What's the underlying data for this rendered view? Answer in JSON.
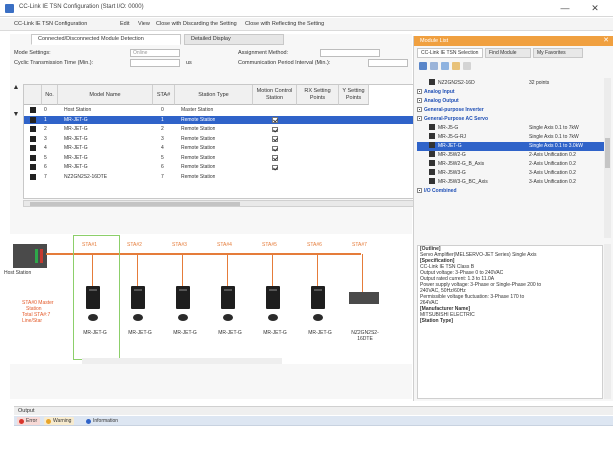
{
  "window": {
    "title": "CC-Link IE TSN Configuration (Start I/O: 0000)",
    "min_glyph": "—",
    "close_glyph": "✕"
  },
  "menu": [
    "CC-Link IE TSN Configuration",
    "Edit",
    "View",
    "Close with Discarding the Setting",
    "Close with Reflecting the Setting"
  ],
  "tabs": [
    "Connected/Disconnected Module Detection",
    "Detailed Display"
  ],
  "settings": {
    "mode_label": "Mode Settings:",
    "mode_value": "Online",
    "cyclic_label": "Cyclic Transmission Time (Min.):",
    "cyclic_unit": "us",
    "assignment_label": "Assignment Method:",
    "comm_period_label": "Communication Period Interval (Min.):"
  },
  "grid": {
    "headers": [
      "",
      "No.",
      "Model Name",
      "STA#",
      "Station Type",
      "Motion Control Station",
      "RX Setting Points",
      "Y Setting Points"
    ],
    "rows": [
      {
        "no": "0",
        "model": "Host Station",
        "sta": "0",
        "type": "Master Station",
        "motion": false,
        "selected": false
      },
      {
        "no": "1",
        "model": "MR-JET-G",
        "sta": "1",
        "type": "Remote Station",
        "motion": true,
        "selected": true
      },
      {
        "no": "2",
        "model": "MR-JET-G",
        "sta": "2",
        "type": "Remote Station",
        "motion": true,
        "selected": false
      },
      {
        "no": "3",
        "model": "MR-JET-G",
        "sta": "3",
        "type": "Remote Station",
        "motion": true,
        "selected": false
      },
      {
        "no": "4",
        "model": "MR-JET-G",
        "sta": "4",
        "type": "Remote Station",
        "motion": true,
        "selected": false
      },
      {
        "no": "5",
        "model": "MR-JET-G",
        "sta": "5",
        "type": "Remote Station",
        "motion": true,
        "selected": false
      },
      {
        "no": "6",
        "model": "MR-JET-G",
        "sta": "6",
        "type": "Remote Station",
        "motion": true,
        "selected": false
      },
      {
        "no": "7",
        "model": "NZ2GN2S2-16DTE",
        "sta": "7",
        "type": "Remote Station",
        "motion": false,
        "selected": false
      }
    ]
  },
  "diagram": {
    "host_label": "Host Station",
    "stations": [
      "STA#1",
      "STA#2",
      "STA#3",
      "STA#4",
      "STA#5",
      "STA#6",
      "STA#7"
    ],
    "modules": [
      "MR-JET-G",
      "MR-JET-G",
      "MR-JET-G",
      "MR-JET-G",
      "MR-JET-G",
      "MR-JET-G",
      "NZ2GN2S2-16DTE"
    ],
    "master_note": [
      "STA#0 Master",
      "Station",
      "Total STA#:7",
      "Line/Star"
    ]
  },
  "module_list": {
    "title": "Module List",
    "close_glyph": "✕",
    "tabs": [
      "CC-Link IE TSN Selection",
      "Find Module",
      "My Favorites"
    ],
    "items": [
      {
        "kind": "item",
        "label": "NZ2GN2S2-16D",
        "value": "32 points"
      },
      {
        "kind": "cat",
        "label": "Analog Input"
      },
      {
        "kind": "cat",
        "label": "Analog Output"
      },
      {
        "kind": "cat",
        "label": "General-purpose Inverter"
      },
      {
        "kind": "cat",
        "label": "General-Purpose AC Servo"
      },
      {
        "kind": "item",
        "label": "MR-J5-G",
        "value": "Single Axis 0.1 to 7kW"
      },
      {
        "kind": "item",
        "label": "MR-J5-G-RJ",
        "value": "Single Axis 0.1 to 7kW"
      },
      {
        "kind": "item",
        "label": "MR-JET-G",
        "value": "Single Axis 0.1 to 3.0kW",
        "selected": true
      },
      {
        "kind": "item",
        "label": "MR-J5W2-G",
        "value": "2-Axis Unification 0.2"
      },
      {
        "kind": "item",
        "label": "MR-J5W2-G_B_Axis",
        "value": "2-Axis Unification 0.2"
      },
      {
        "kind": "item",
        "label": "MR-J5W3-G",
        "value": "3-Axis Unification 0.2"
      },
      {
        "kind": "item",
        "label": "MR-J5W3-G_BC_Axis",
        "value": "3-Axis Unification 0.2"
      },
      {
        "kind": "cat",
        "label": "I/O Combined"
      }
    ],
    "outline": [
      {
        "text": "[Outline]",
        "h": true
      },
      {
        "text": "Servo Amplifier(MELSERVO-JET Series) Single Axis",
        "h": false
      },
      {
        "text": "[Specification]",
        "h": true
      },
      {
        "text": "CC-Link IE TSN Class B",
        "h": false
      },
      {
        "text": "Output voltage: 3-Phase 0 to 240VAC",
        "h": false
      },
      {
        "text": "Output rated current: 1.3 to 11.0A",
        "h": false
      },
      {
        "text": "Power supply voltage: 3-Phase or Single-Phase 200 to",
        "h": false
      },
      {
        "text": "240VAC, 50Hz/60Hz",
        "h": false
      },
      {
        "text": "Permissible voltage fluctuation: 3-Phase 170 to",
        "h": false
      },
      {
        "text": "264VAC",
        "h": false
      },
      {
        "text": "[Manufacturer Name]",
        "h": true
      },
      {
        "text": "MITSUBISHI ELECTRIC",
        "h": false
      },
      {
        "text": "[Station Type]",
        "h": true
      }
    ]
  },
  "output": {
    "title": "Output",
    "tabs": [
      "Error",
      "Warning",
      "Information"
    ],
    "colors": {
      "error": "#d9342b",
      "warning": "#e8a52a",
      "information": "#2f63c9"
    }
  },
  "colors": {
    "accent": "#2f63c9",
    "bus": "#e57c3a",
    "module_list_header": "#f0a040",
    "selection_frame": "#8ccf6a"
  }
}
